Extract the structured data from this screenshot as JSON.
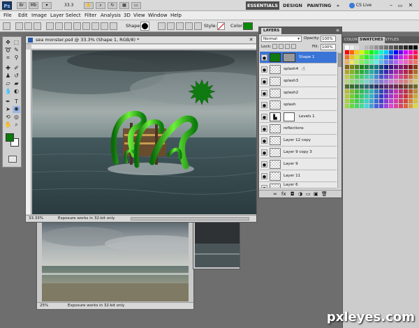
{
  "app": {
    "logo": "Ps",
    "zoom": "33.3",
    "workspaces": [
      "ESSENTIALS",
      "DESIGN",
      "PAINTING"
    ],
    "more": "»",
    "cs_live": "CS Live"
  },
  "menu": [
    "File",
    "Edit",
    "Image",
    "Layer",
    "Select",
    "Filter",
    "Analysis",
    "3D",
    "View",
    "Window",
    "Help"
  ],
  "options": {
    "shape_label": "Shape:",
    "style_label": "Style:",
    "color_label": "Color:",
    "color_value": "#0a8a0a"
  },
  "doc_main": {
    "title": "sea monster.psd @ 33.3% (Shape 1, RGB/8) *",
    "zoom": "33.33%",
    "status": "Exposure works in 32-bit only"
  },
  "doc_back": {
    "zoom": "25%",
    "status": "Exposure works in 32-bit only"
  },
  "layers_panel": {
    "tab": "LAYERS",
    "blend_mode": "Normal",
    "opacity_label": "Opacity:",
    "opacity": "100%",
    "lock_label": "Lock:",
    "fill_label": "Fill:",
    "fill": "100%",
    "layers": [
      {
        "name": "Shape 1",
        "selected": true
      },
      {
        "name": "splash4"
      },
      {
        "name": "splash3"
      },
      {
        "name": "splash2"
      },
      {
        "name": "splash"
      },
      {
        "name": "Levels 1"
      },
      {
        "name": "reflections"
      },
      {
        "name": "Layer 12 copy"
      },
      {
        "name": "Layer 9 copy 3"
      },
      {
        "name": "Layer 9"
      },
      {
        "name": "Layer 11"
      },
      {
        "name": "Layer 6"
      }
    ]
  },
  "swatch_panel": {
    "tabs": [
      "COLOR",
      "SWATCHES",
      "STYLES"
    ]
  },
  "colors": {
    "foreground": "#0a7a0a",
    "background": "#ffffff",
    "selection": "#3a74d6"
  },
  "watermark": "pxleyes.com"
}
